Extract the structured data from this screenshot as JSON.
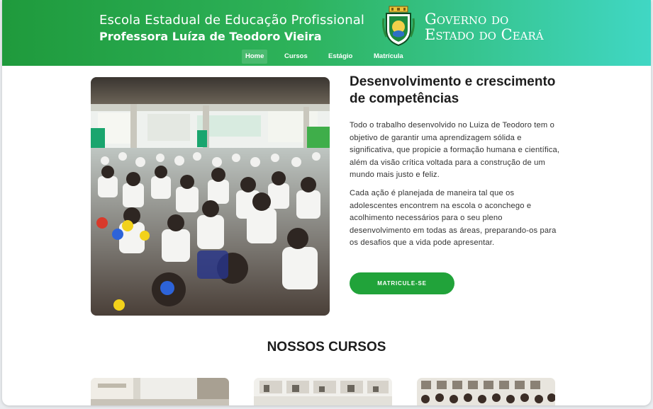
{
  "header": {
    "school_name_line1": "Escola Estadual de Educação Profissional",
    "school_name_line2": "Professora Luíza de Teodoro Vieira",
    "government_line1": "Governo do",
    "government_line2": "Estado do Ceará",
    "crest_icon": "ceara-coat-of-arms-icon"
  },
  "nav": {
    "items": [
      {
        "label": "Home",
        "active": true
      },
      {
        "label": "Cursos",
        "active": false
      },
      {
        "label": "Estágio",
        "active": false
      },
      {
        "label": "Matrícula",
        "active": false
      }
    ]
  },
  "hero": {
    "image_description": "students-in-school-courtyard-photo",
    "headline": "Desenvolvimento e crescimento de competências",
    "paragraph1": "Todo o trabalho desenvolvido no Luiza de Teodoro tem o objetivo de garantir uma aprendizagem sólida e significativa, que propicie a formação humana e científica, além da visão crítica voltada para a construção de um mundo mais justo e feliz.",
    "paragraph2": "Cada ação é planejada de maneira tal que os adolescentes encontrem na escola o aconchego e acolhimento necessários para o seu pleno desenvolvimento em todas as áreas, preparando-os para os desafios que a vida pode apresentar.",
    "cta_label": "MATRICULE-SE"
  },
  "courses": {
    "section_title": "NOSSOS CURSOS"
  },
  "colors": {
    "header_gradient_start": "#1f9a3c",
    "header_gradient_end": "#40d7c4",
    "cta_background": "#21a33a"
  }
}
